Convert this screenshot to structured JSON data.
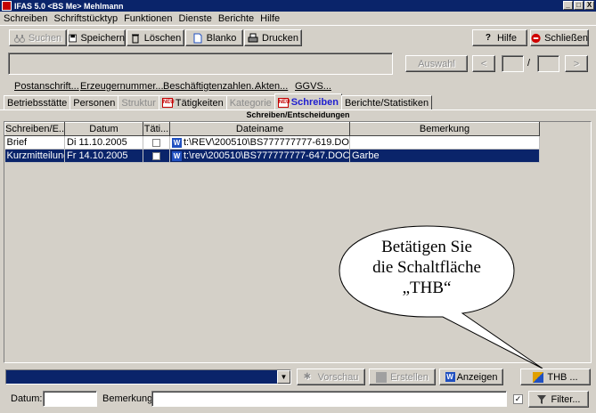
{
  "window": {
    "title": "IFAS 5.0  <BS Me> Mehlmann",
    "min": "_",
    "max": "□",
    "close": "X"
  },
  "menu": [
    "Schreiben",
    "Schriftstücktyp",
    "Funktionen",
    "Dienste",
    "Berichte",
    "Hilfe"
  ],
  "toolbar": {
    "suchen": "Suchen",
    "speichern": "Speichern",
    "loeschen": "Löschen",
    "blanko": "Blanko",
    "drucken": "Drucken",
    "hilfe": "Hilfe",
    "schliessen": "Schließen"
  },
  "nav": {
    "auswahl": "Auswahl",
    "prev": "<",
    "sep": "/",
    "next": ">"
  },
  "links": [
    "Postanschrift...",
    "Erzeugernummer...",
    "Beschäftigtenzahlen...",
    "Akten...",
    "GGVS..."
  ],
  "tabs": [
    {
      "label": "Betriebsstätte",
      "state": "normal"
    },
    {
      "label": "Personen",
      "state": "normal"
    },
    {
      "label": "Struktur",
      "state": "disabled"
    },
    {
      "label": "Tätigkeiten",
      "state": "normal",
      "badge": "NEU"
    },
    {
      "label": "Kategorie",
      "state": "disabled"
    },
    {
      "label": "Schreiben",
      "state": "active",
      "badge": "NEU"
    },
    {
      "label": "Berichte/Statistiken",
      "state": "normal"
    }
  ],
  "section_title": "Schreiben/Entscheidungen",
  "table": {
    "columns": [
      "Schreiben/E...",
      "Datum",
      "Täti...",
      "Dateiname",
      "Bemerkung"
    ],
    "rows": [
      {
        "type": "Brief",
        "datum": "Di 11.10.2005",
        "file": "t:\\REV\\200510\\BS777777777-619.DOC",
        "bemerkung": ""
      },
      {
        "type": "Kurzmitteilung",
        "datum": "Fr 14.10.2005",
        "file": "t:\\rev\\200510\\BS777777777-647.DOC",
        "bemerkung": "Garbe"
      }
    ]
  },
  "callout": [
    "Betätigen Sie",
    "die Schaltfläche",
    "„THB“"
  ],
  "bottom": {
    "vorschau": "Vorschau",
    "erstellen": "Erstellen",
    "anzeigen": "Anzeigen",
    "thb": "THB ...",
    "datum_label": "Datum:",
    "bemerkung_label": "Bemerkung:",
    "filter": "Filter..."
  }
}
